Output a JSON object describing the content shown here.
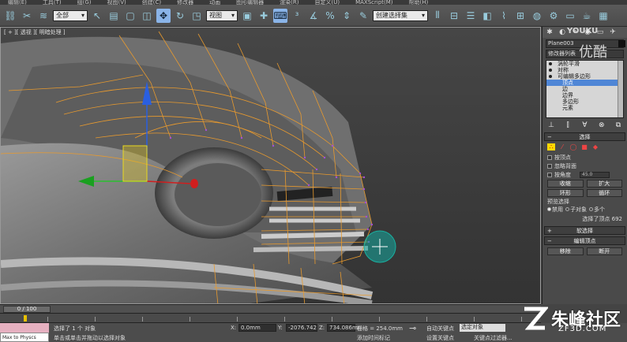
{
  "menu": {
    "items": [
      "编辑(E)",
      "工具(T)",
      "组(G)",
      "视图(V)",
      "创建(C)",
      "修改器",
      "动画",
      "图形编辑器",
      "渲染(R)",
      "自定义(U)",
      "MAXScript(M)",
      "帮助(H)"
    ]
  },
  "toolbar": {
    "filter_value": "全部",
    "ref_coord_value": "视图",
    "named_sel_value": "创建选择集"
  },
  "viewport": {
    "label": "[ + ][ 透视 ][ 明暗处理 ]"
  },
  "panel": {
    "object_name": "Plane003",
    "modifier_list_label": "修改器列表",
    "stack": [
      {
        "label": "涡轮平滑",
        "level": "top"
      },
      {
        "label": "对称",
        "level": "top"
      },
      {
        "label": "可编辑多边形",
        "level": "top"
      },
      {
        "label": "顶点",
        "level": "sub",
        "highlighted": true
      },
      {
        "label": "边",
        "level": "sub"
      },
      {
        "label": "边界",
        "level": "sub"
      },
      {
        "label": "多边形",
        "level": "sub"
      },
      {
        "label": "元素",
        "level": "sub"
      }
    ],
    "selection_rollout": "选择",
    "by_vertex": "按顶点",
    "ignore_backfacing": "忽略背面",
    "by_angle": "按角度",
    "angle_value": "45.0",
    "shrink": "收缩",
    "grow": "扩大",
    "ring": "环形",
    "loop": "循环",
    "preview_selection": "预览选择",
    "preview_options": [
      "禁用",
      "子对象",
      "多个"
    ],
    "selection_info": "选择了顶点 692",
    "soft_selection": "软选择",
    "edit_vertices": "编辑顶点",
    "remove": "移除",
    "break": "断开"
  },
  "timeline": {
    "frame_label": "0 / 100"
  },
  "status": {
    "script_line1": "",
    "script_line2": "Max to Physcs",
    "selection_text": "选择了 1 个 对象",
    "prompt_text": "单击或单击并拖动以选择对象",
    "x_label": "X:",
    "x_value": "0.0mm",
    "y_label": "Y:",
    "y_value": "-2076.742",
    "z_label": "Z:",
    "z_value": "734.086mr",
    "grid_text": "栅格 = 254.0mm",
    "add_time_tag": "添加时间标记",
    "auto_key": "自动关键点",
    "selected_object": "选定对象",
    "set_key": "设置关键点",
    "key_filters": "关键点过滤器..."
  },
  "watermarks": {
    "youku1": "YOUKU",
    "youku2": "优酷",
    "zhufeng": "朱峰社区",
    "site": "ZF3D.COM"
  }
}
